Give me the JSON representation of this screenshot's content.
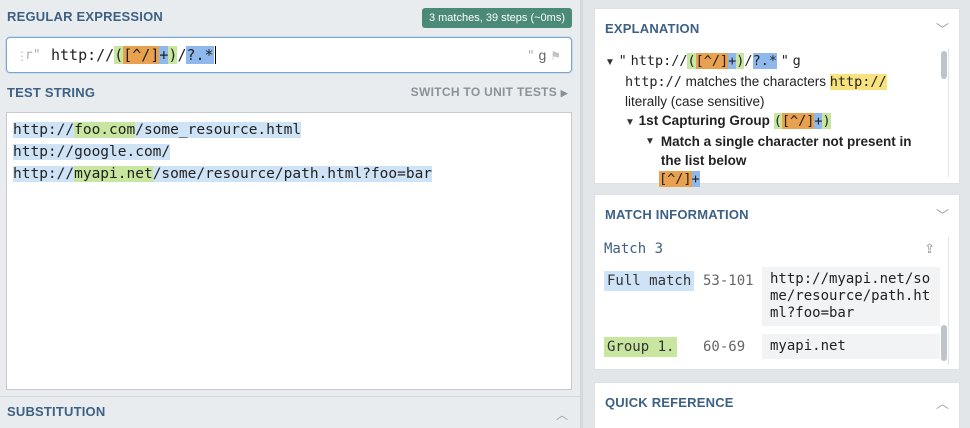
{
  "regex": {
    "title": "REGULAR EXPRESSION",
    "badge": "3 matches, 39 steps (~0ms)",
    "delim_left": "r\"",
    "pattern": {
      "part1": "http://",
      "paren_open": "(",
      "char_class": "[^/]",
      "plus": "+",
      "paren_close": ")",
      "slash": "/",
      "tail": "?.*"
    },
    "delim_right": "\"",
    "flags": "g"
  },
  "test_string": {
    "title": "TEST STRING",
    "switch_label": "SWITCH TO UNIT TESTS",
    "lines": [
      {
        "a": "http://",
        "b": "foo.com",
        "c": "/some_resource.html"
      },
      {
        "a": "http://",
        "b": "google.com",
        "c": "/"
      },
      {
        "a": "http://",
        "b": "myapi.net",
        "c": "/some/resource/path.html?foo=bar"
      }
    ]
  },
  "substitution": {
    "title": "SUBSTITUTION"
  },
  "explanation": {
    "title": "EXPLANATION",
    "line1": {
      "q1": "\"",
      "p1": "http://",
      "po": "(",
      "cc": "[^/]",
      "pl": "+",
      "pc": ")",
      "sl": "/",
      "tail": "?.*",
      "q2": "\"",
      "flag": "g"
    },
    "line2": {
      "lit": "http://",
      "text1": "matches the characters",
      "code": "http://"
    },
    "line3": "literally (case sensitive)",
    "group": {
      "label": "1st Capturing Group",
      "po": "(",
      "cc": "[^/]",
      "pl": "+",
      "pc": ")"
    },
    "match_single": "Match a single character not present in the list below",
    "list": {
      "cc": "[^/]",
      "pl": "+"
    }
  },
  "match_info": {
    "title": "MATCH INFORMATION",
    "match_label": "Match 3",
    "full_match": {
      "label": "Full match",
      "range": "53-101",
      "value": "http://myapi.net/some/resource/path.html?foo=bar"
    },
    "group1": {
      "label": "Group 1.",
      "range": "60-69",
      "value": "myapi.net"
    }
  },
  "quick_reference": {
    "title": "QUICK REFERENCE"
  },
  "colors": {
    "accent": "#3d6185",
    "badge": "#4a8a76",
    "group": "#c8e6a0",
    "class": "#e8a24f",
    "quant": "#8fb8ec"
  }
}
